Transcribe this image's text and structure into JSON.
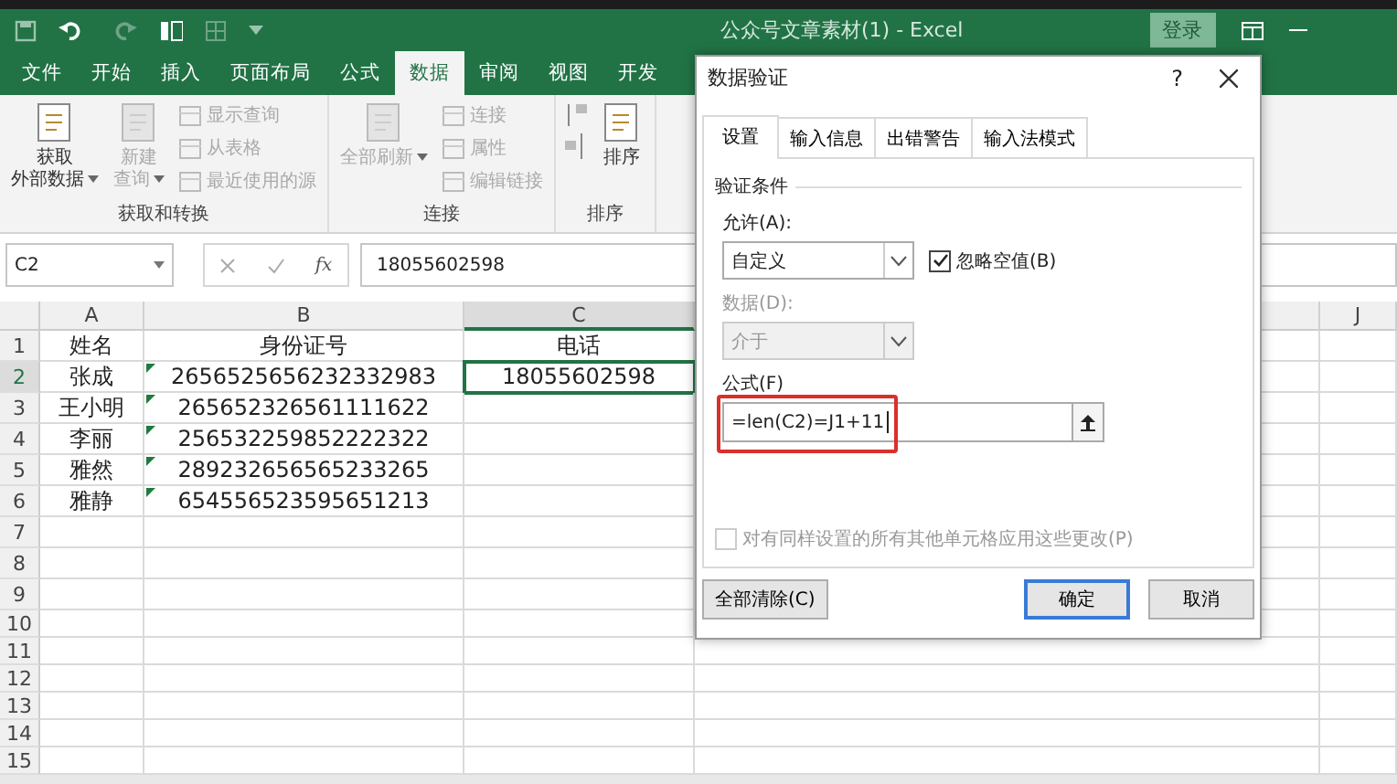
{
  "window": {
    "title": "公众号文章素材(1) - Excel",
    "login_button": "登录"
  },
  "ribbon_tabs": [
    {
      "label": "文件",
      "selected": false
    },
    {
      "label": "开始",
      "selected": false
    },
    {
      "label": "插入",
      "selected": false
    },
    {
      "label": "页面布局",
      "selected": false
    },
    {
      "label": "公式",
      "selected": false
    },
    {
      "label": "数据",
      "selected": true
    },
    {
      "label": "审阅",
      "selected": false
    },
    {
      "label": "视图",
      "selected": false
    },
    {
      "label": "开发",
      "selected": false
    }
  ],
  "ribbon_groups": [
    {
      "label": "获取和转换",
      "large_buttons": [
        {
          "lines": [
            "获取",
            "外部数据"
          ],
          "disabled": false,
          "dropdown": true
        },
        {
          "lines": [
            "新建",
            "查询"
          ],
          "disabled": true,
          "dropdown": true
        }
      ],
      "small_buttons": [
        {
          "label": "显示查询",
          "disabled": true
        },
        {
          "label": "从表格",
          "disabled": true
        },
        {
          "label": "最近使用的源",
          "disabled": true
        }
      ]
    },
    {
      "label": "连接",
      "large_buttons": [
        {
          "lines": [
            "全部刷新"
          ],
          "disabled": true,
          "dropdown": true
        }
      ],
      "small_buttons": [
        {
          "label": "连接",
          "disabled": true
        },
        {
          "label": "属性",
          "disabled": true
        },
        {
          "label": "编辑链接",
          "disabled": true
        }
      ]
    },
    {
      "label": "排序",
      "large_buttons": [
        {
          "lines": [
            "排序"
          ],
          "disabled": false,
          "dropdown": false
        }
      ]
    }
  ],
  "formula_bar": {
    "name_box": "C2",
    "function_symbol": "fx",
    "value": "18055602598"
  },
  "sheet": {
    "columns": [
      "A",
      "B",
      "C",
      "J"
    ],
    "rows": [
      {
        "number": "1",
        "cells": [
          {
            "text": "姓名",
            "selected": false,
            "warning": false
          },
          {
            "text": "身份证号",
            "selected": false,
            "warning": false
          },
          {
            "text": "电话",
            "selected": false,
            "warning": false
          }
        ]
      },
      {
        "number": "2",
        "cells": [
          {
            "text": "张成",
            "selected": false,
            "warning": false
          },
          {
            "text": "2656525656232332983",
            "selected": false,
            "warning": true
          },
          {
            "text": "18055602598",
            "selected": true,
            "warning": false
          }
        ]
      },
      {
        "number": "3",
        "cells": [
          {
            "text": "王小明",
            "selected": false,
            "warning": false
          },
          {
            "text": "265652326561111622",
            "selected": false,
            "warning": true
          }
        ]
      },
      {
        "number": "4",
        "cells": [
          {
            "text": "李丽",
            "selected": false,
            "warning": false
          },
          {
            "text": "256532259852222322",
            "selected": false,
            "warning": true
          }
        ]
      },
      {
        "number": "5",
        "cells": [
          {
            "text": "雅然",
            "selected": false,
            "warning": false
          },
          {
            "text": "289232656565233265",
            "selected": false,
            "warning": true
          }
        ]
      },
      {
        "number": "6",
        "cells": [
          {
            "text": "雅静",
            "selected": false,
            "warning": false
          },
          {
            "text": "654556523595651213",
            "selected": false,
            "warning": true
          }
        ]
      },
      {
        "number": "7"
      },
      {
        "number": "8"
      },
      {
        "number": "9"
      },
      {
        "number": "10"
      },
      {
        "number": "11"
      },
      {
        "number": "12"
      },
      {
        "number": "13"
      },
      {
        "number": "14"
      },
      {
        "number": "15"
      }
    ]
  },
  "dialog": {
    "title": "数据验证",
    "help": "?",
    "tabs": [
      {
        "label": "设置",
        "selected": true
      },
      {
        "label": "输入信息",
        "selected": false
      },
      {
        "label": "出错警告",
        "selected": false
      },
      {
        "label": "输入法模式",
        "selected": false
      }
    ],
    "section_title": "验证条件",
    "allow_label": "允许(A):",
    "allow_value": "自定义",
    "ignore_blank": {
      "label": "忽略空值(B)",
      "checked": true
    },
    "data_label": "数据(D):",
    "data_value": "介于",
    "data_disabled": true,
    "formula_label": "公式(F)",
    "formula_value": "=len(C2)=J1+11",
    "formula_highlighted": true,
    "apply_all": {
      "label": "对有同样设置的所有其他单元格应用这些更改(P)",
      "checked": false,
      "disabled": true
    },
    "buttons": [
      {
        "label": "全部清除(C)",
        "kind": "secondary"
      },
      {
        "label": "确定",
        "kind": "default"
      },
      {
        "label": "取消",
        "kind": "secondary"
      }
    ]
  }
}
